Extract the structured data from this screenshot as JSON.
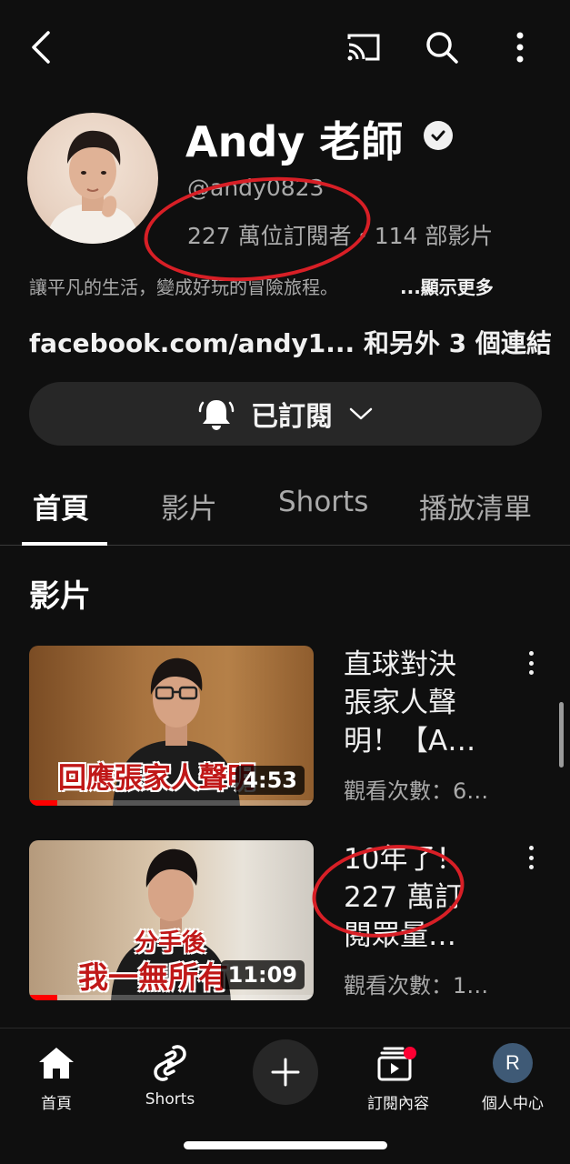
{
  "channel": {
    "name": "Andy 老師",
    "handle": "@andy0823",
    "subscribers": "227 萬位訂閱者",
    "separator": "・",
    "video_count": "114 部影片",
    "description": "讓平凡的生活，變成好玩的冒險旅程。",
    "show_more": "...顯示更多",
    "links": "facebook.com/andy1... 和另外 3 個連結"
  },
  "subscribe_button": {
    "label": "已訂閱",
    "icon": "bell-icon"
  },
  "tabs": [
    {
      "label": "首頁",
      "active": true
    },
    {
      "label": "影片",
      "active": false
    },
    {
      "label": "Shorts",
      "active": false
    },
    {
      "label": "播放清單",
      "active": false
    }
  ],
  "section_title": "影片",
  "videos": [
    {
      "title_line1": "直球對決",
      "title_line2": "張家人聲",
      "title_line3": "明！【A…",
      "views": "觀看次數：6…",
      "duration": "4:53",
      "thumb_text": "回應張家人聲明",
      "progress": 0.1
    },
    {
      "title_line1": "10年了！",
      "title_line2": "227 萬訂",
      "title_line3": "閱眾量…",
      "views": "觀看次數：1…",
      "duration": "11:09",
      "thumb_text_top": "分手後",
      "thumb_text": "我一無所有",
      "progress": 0.1
    }
  ],
  "bottom_nav": [
    {
      "label": "首頁",
      "icon": "home-icon"
    },
    {
      "label": "Shorts",
      "icon": "shorts-icon"
    },
    {
      "label": "",
      "icon": "plus-icon"
    },
    {
      "label": "訂閱內容",
      "icon": "subscriptions-icon"
    },
    {
      "label": "個人中心",
      "icon": "avatar",
      "avatar_letter": "R"
    }
  ],
  "colors": {
    "background": "#0f0f0f",
    "annotation": "#d81f26",
    "progress": "#ff0000"
  }
}
